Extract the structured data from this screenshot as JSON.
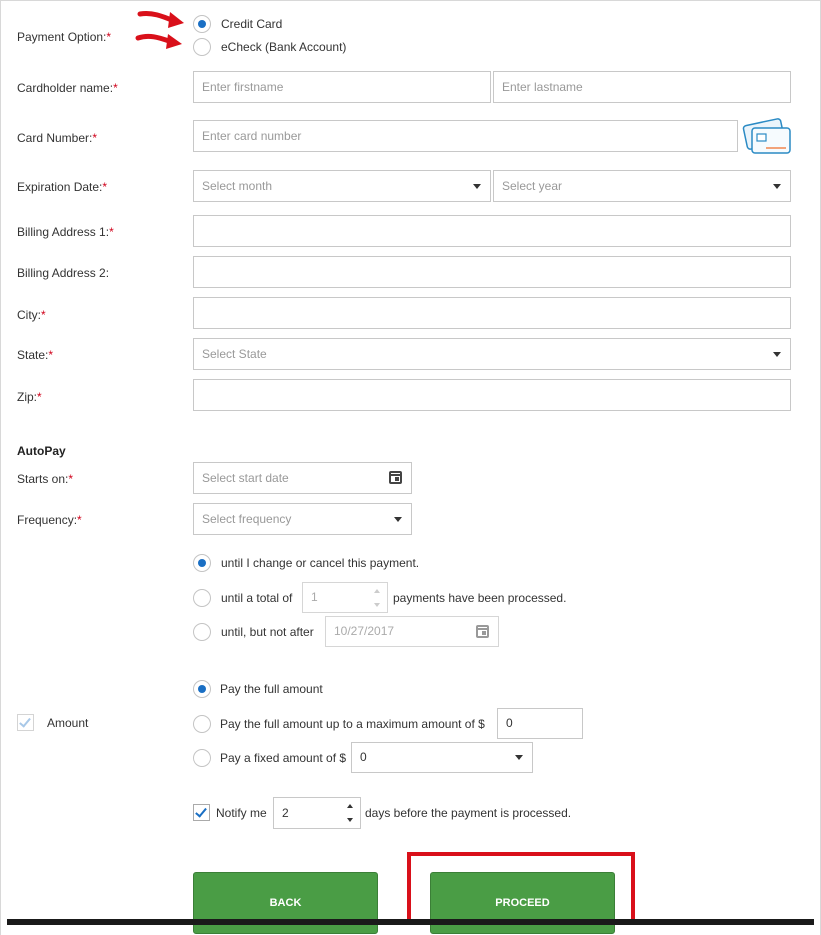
{
  "payment": {
    "label": "Payment Option:",
    "options": [
      "Credit Card",
      "eCheck (Bank Account)"
    ],
    "selected": 0
  },
  "cardholder": {
    "label": "Cardholder name:",
    "first_placeholder": "Enter firstname",
    "last_placeholder": "Enter lastname"
  },
  "card_number": {
    "label": "Card Number:",
    "placeholder": "Enter card number"
  },
  "expiration": {
    "label": "Expiration Date:",
    "month_placeholder": "Select month",
    "year_placeholder": "Select year"
  },
  "billing1": {
    "label": "Billing Address 1:"
  },
  "billing2": {
    "label": "Billing Address 2:"
  },
  "city": {
    "label": "City:"
  },
  "state": {
    "label": "State:",
    "placeholder": "Select State"
  },
  "zip": {
    "label": "Zip:"
  },
  "autopay": {
    "heading": "AutoPay",
    "starts_label": "Starts on:",
    "start_placeholder": "Select start date",
    "frequency_label": "Frequency:",
    "frequency_placeholder": "Select frequency",
    "until_options": {
      "change": "until I change or cancel this payment.",
      "total_prefix": "until a total of",
      "total_value": "1",
      "total_suffix": "payments have been processed.",
      "date_prefix": "until, but not after",
      "date_value": "10/27/2017"
    },
    "until_selected": 0
  },
  "amount": {
    "label": "Amount",
    "full": "Pay the full amount",
    "max_prefix": "Pay the full amount up to a maximum amount of $",
    "max_value": "0",
    "fixed_prefix": "Pay a fixed amount of $",
    "fixed_value": "0",
    "selected": 0
  },
  "notify": {
    "prefix": "Notify me",
    "days": "2",
    "suffix": "days before the payment is processed."
  },
  "buttons": {
    "back": "BACK",
    "proceed": "PROCEED"
  },
  "colors": {
    "accent": "#1a6fc4",
    "button": "#4a9d45",
    "required": "#d0021b",
    "annotation": "#d9101a"
  }
}
